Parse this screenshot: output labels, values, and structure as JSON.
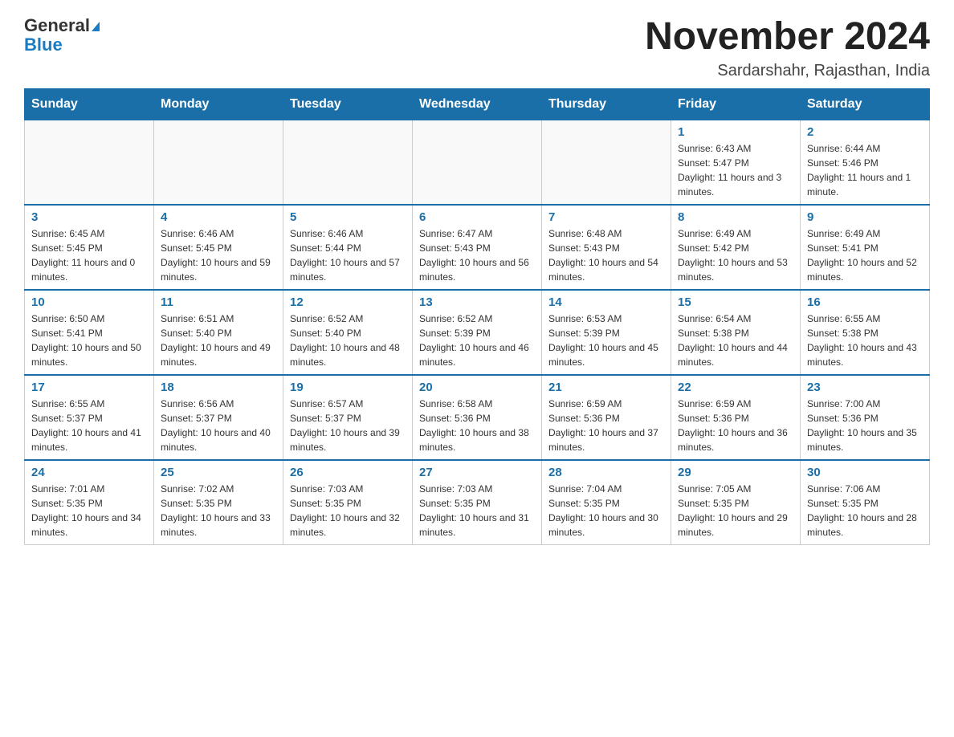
{
  "logo": {
    "general": "General",
    "blue": "Blue"
  },
  "header": {
    "month_year": "November 2024",
    "location": "Sardarshahr, Rajasthan, India"
  },
  "days_of_week": [
    "Sunday",
    "Monday",
    "Tuesday",
    "Wednesday",
    "Thursday",
    "Friday",
    "Saturday"
  ],
  "weeks": [
    [
      {
        "day": "",
        "info": ""
      },
      {
        "day": "",
        "info": ""
      },
      {
        "day": "",
        "info": ""
      },
      {
        "day": "",
        "info": ""
      },
      {
        "day": "",
        "info": ""
      },
      {
        "day": "1",
        "info": "Sunrise: 6:43 AM\nSunset: 5:47 PM\nDaylight: 11 hours and 3 minutes."
      },
      {
        "day": "2",
        "info": "Sunrise: 6:44 AM\nSunset: 5:46 PM\nDaylight: 11 hours and 1 minute."
      }
    ],
    [
      {
        "day": "3",
        "info": "Sunrise: 6:45 AM\nSunset: 5:45 PM\nDaylight: 11 hours and 0 minutes."
      },
      {
        "day": "4",
        "info": "Sunrise: 6:46 AM\nSunset: 5:45 PM\nDaylight: 10 hours and 59 minutes."
      },
      {
        "day": "5",
        "info": "Sunrise: 6:46 AM\nSunset: 5:44 PM\nDaylight: 10 hours and 57 minutes."
      },
      {
        "day": "6",
        "info": "Sunrise: 6:47 AM\nSunset: 5:43 PM\nDaylight: 10 hours and 56 minutes."
      },
      {
        "day": "7",
        "info": "Sunrise: 6:48 AM\nSunset: 5:43 PM\nDaylight: 10 hours and 54 minutes."
      },
      {
        "day": "8",
        "info": "Sunrise: 6:49 AM\nSunset: 5:42 PM\nDaylight: 10 hours and 53 minutes."
      },
      {
        "day": "9",
        "info": "Sunrise: 6:49 AM\nSunset: 5:41 PM\nDaylight: 10 hours and 52 minutes."
      }
    ],
    [
      {
        "day": "10",
        "info": "Sunrise: 6:50 AM\nSunset: 5:41 PM\nDaylight: 10 hours and 50 minutes."
      },
      {
        "day": "11",
        "info": "Sunrise: 6:51 AM\nSunset: 5:40 PM\nDaylight: 10 hours and 49 minutes."
      },
      {
        "day": "12",
        "info": "Sunrise: 6:52 AM\nSunset: 5:40 PM\nDaylight: 10 hours and 48 minutes."
      },
      {
        "day": "13",
        "info": "Sunrise: 6:52 AM\nSunset: 5:39 PM\nDaylight: 10 hours and 46 minutes."
      },
      {
        "day": "14",
        "info": "Sunrise: 6:53 AM\nSunset: 5:39 PM\nDaylight: 10 hours and 45 minutes."
      },
      {
        "day": "15",
        "info": "Sunrise: 6:54 AM\nSunset: 5:38 PM\nDaylight: 10 hours and 44 minutes."
      },
      {
        "day": "16",
        "info": "Sunrise: 6:55 AM\nSunset: 5:38 PM\nDaylight: 10 hours and 43 minutes."
      }
    ],
    [
      {
        "day": "17",
        "info": "Sunrise: 6:55 AM\nSunset: 5:37 PM\nDaylight: 10 hours and 41 minutes."
      },
      {
        "day": "18",
        "info": "Sunrise: 6:56 AM\nSunset: 5:37 PM\nDaylight: 10 hours and 40 minutes."
      },
      {
        "day": "19",
        "info": "Sunrise: 6:57 AM\nSunset: 5:37 PM\nDaylight: 10 hours and 39 minutes."
      },
      {
        "day": "20",
        "info": "Sunrise: 6:58 AM\nSunset: 5:36 PM\nDaylight: 10 hours and 38 minutes."
      },
      {
        "day": "21",
        "info": "Sunrise: 6:59 AM\nSunset: 5:36 PM\nDaylight: 10 hours and 37 minutes."
      },
      {
        "day": "22",
        "info": "Sunrise: 6:59 AM\nSunset: 5:36 PM\nDaylight: 10 hours and 36 minutes."
      },
      {
        "day": "23",
        "info": "Sunrise: 7:00 AM\nSunset: 5:36 PM\nDaylight: 10 hours and 35 minutes."
      }
    ],
    [
      {
        "day": "24",
        "info": "Sunrise: 7:01 AM\nSunset: 5:35 PM\nDaylight: 10 hours and 34 minutes."
      },
      {
        "day": "25",
        "info": "Sunrise: 7:02 AM\nSunset: 5:35 PM\nDaylight: 10 hours and 33 minutes."
      },
      {
        "day": "26",
        "info": "Sunrise: 7:03 AM\nSunset: 5:35 PM\nDaylight: 10 hours and 32 minutes."
      },
      {
        "day": "27",
        "info": "Sunrise: 7:03 AM\nSunset: 5:35 PM\nDaylight: 10 hours and 31 minutes."
      },
      {
        "day": "28",
        "info": "Sunrise: 7:04 AM\nSunset: 5:35 PM\nDaylight: 10 hours and 30 minutes."
      },
      {
        "day": "29",
        "info": "Sunrise: 7:05 AM\nSunset: 5:35 PM\nDaylight: 10 hours and 29 minutes."
      },
      {
        "day": "30",
        "info": "Sunrise: 7:06 AM\nSunset: 5:35 PM\nDaylight: 10 hours and 28 minutes."
      }
    ]
  ]
}
